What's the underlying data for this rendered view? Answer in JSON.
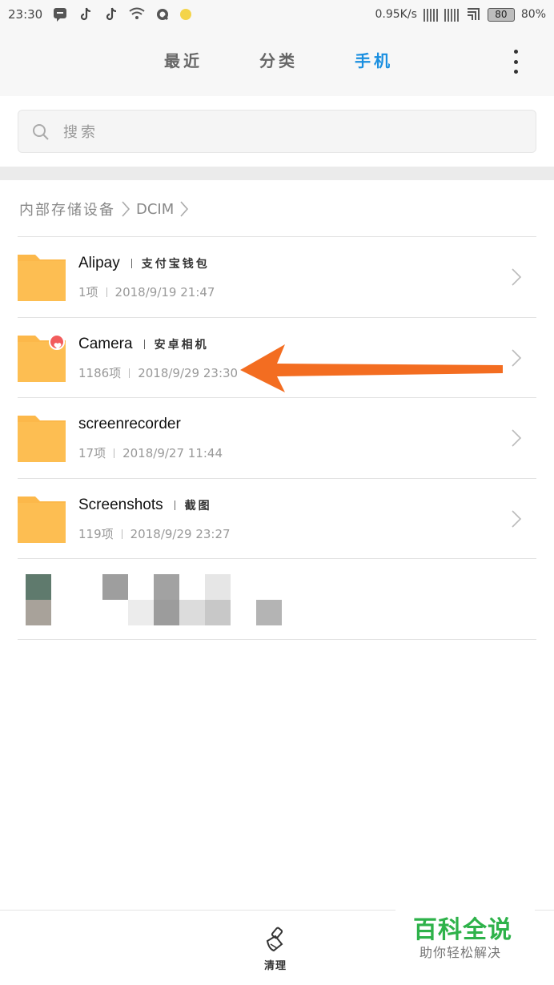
{
  "status_bar": {
    "time": "23:30",
    "speed": "0.95K/s",
    "battery_level": "80",
    "battery_percent": "80%",
    "icons": [
      "chat-bubble-icon",
      "tiktok-icon",
      "tiktok-icon",
      "wifi-icon",
      "q-app-icon",
      "yellow-dot-icon"
    ]
  },
  "header": {
    "tabs": [
      {
        "label": "最近",
        "active": false
      },
      {
        "label": "分类",
        "active": false
      },
      {
        "label": "手机",
        "active": true
      }
    ],
    "active_color": "#1a8fe0"
  },
  "search": {
    "placeholder": "搜索"
  },
  "breadcrumb": {
    "items": [
      "内部存储设备",
      "DCIM"
    ]
  },
  "folders": [
    {
      "name": "Alipay",
      "tag": "支付宝钱包",
      "count": "1项",
      "date": "2018/9/19 21:47"
    },
    {
      "name": "Camera",
      "tag": "安卓相机",
      "count": "1186项",
      "date": "2018/9/29 23:30",
      "badge": "heart-icon"
    },
    {
      "name": "screenrecorder",
      "tag": "",
      "count": "17项",
      "date": "2018/9/27 11:44"
    },
    {
      "name": "Screenshots",
      "tag": "截图",
      "count": "119项",
      "date": "2018/9/29 23:27"
    }
  ],
  "bottom_bar": {
    "clean_label": "清理"
  },
  "watermark": {
    "main": "百科全说",
    "sub": "助你轻松解决"
  },
  "colors": {
    "folder": "#fcb84a",
    "arrow": "#f36d21",
    "watermark_green": "#2eb24a"
  }
}
